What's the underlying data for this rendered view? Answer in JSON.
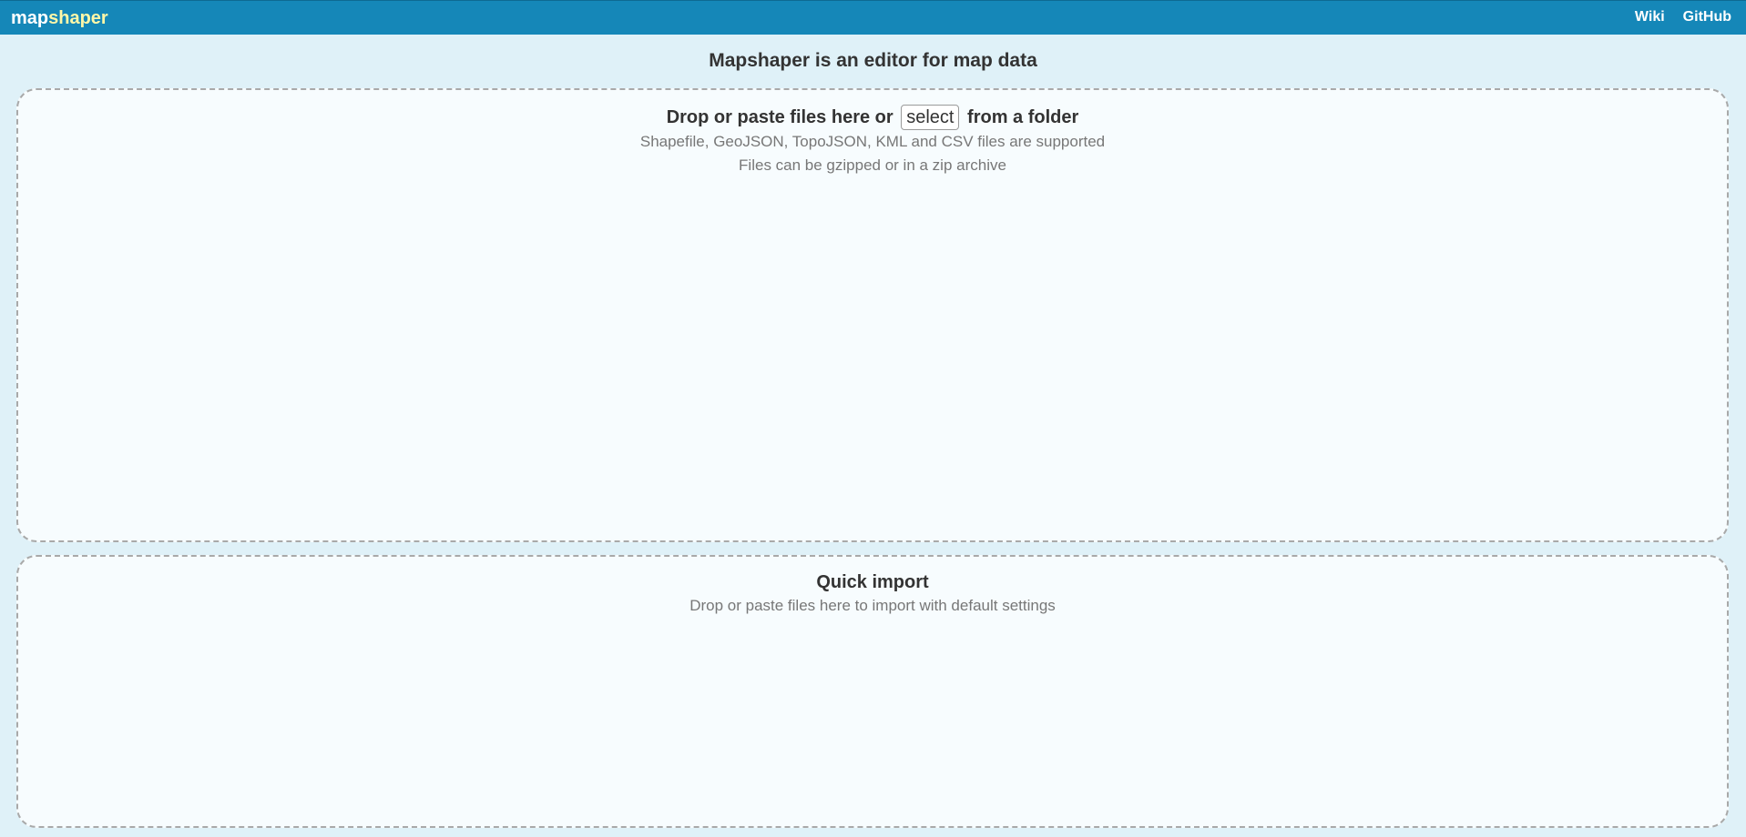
{
  "header": {
    "logo_part1": "map",
    "logo_part2": "shaper",
    "links": [
      "Wiki",
      "GitHub"
    ]
  },
  "page": {
    "title": "Mapshaper is an editor for map data"
  },
  "main_drop": {
    "heading_before": "Drop or paste files here or",
    "select_label": "select",
    "heading_after": "from a folder",
    "line1": "Shapefile, GeoJSON, TopoJSON, KML and CSV files are supported",
    "line2": "Files can be gzipped or in a zip archive"
  },
  "quick_import": {
    "heading": "Quick import",
    "line1": "Drop or paste files here to import with default settings"
  },
  "colors": {
    "header_bg": "#1587b8",
    "logo_accent": "#fff7a8",
    "page_bg": "#dff1f8"
  }
}
